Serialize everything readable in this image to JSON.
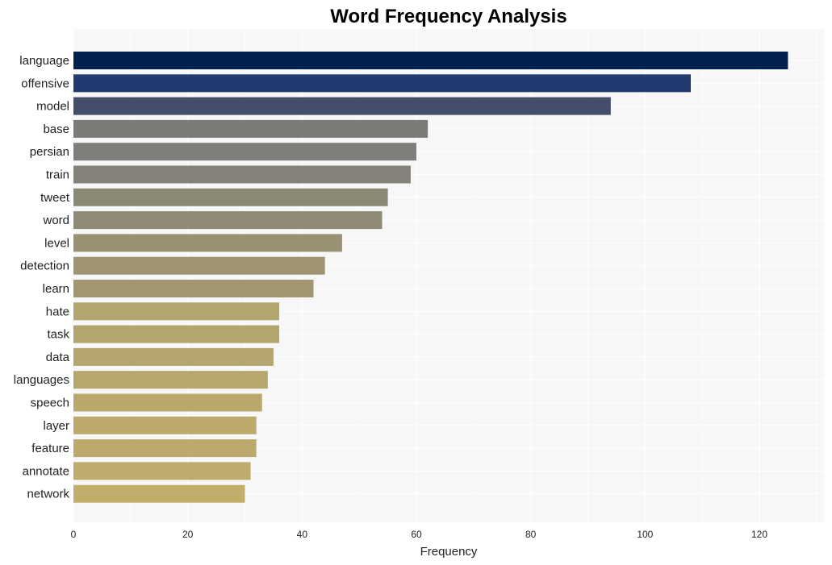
{
  "chart_data": {
    "type": "bar",
    "orientation": "horizontal",
    "title": "Word Frequency Analysis",
    "xlabel": "Frequency",
    "ylabel": "",
    "xlim": [
      0,
      131
    ],
    "xticks": [
      0,
      20,
      40,
      60,
      80,
      100,
      120
    ],
    "grid": true,
    "categories": [
      "language",
      "offensive",
      "model",
      "base",
      "persian",
      "train",
      "tweet",
      "word",
      "level",
      "detection",
      "learn",
      "hate",
      "task",
      "data",
      "languages",
      "speech",
      "layer",
      "feature",
      "annotate",
      "network"
    ],
    "values": [
      125,
      108,
      94,
      62,
      60,
      59,
      55,
      54,
      47,
      44,
      42,
      36,
      36,
      35,
      34,
      33,
      32,
      32,
      31,
      30
    ],
    "colors": [
      "#00204e",
      "#213a6f",
      "#434e6b",
      "#7d7b78",
      "#807e79",
      "#838178",
      "#8b8876",
      "#8e8a76",
      "#9a9172",
      "#9e9471",
      "#a29671",
      "#b3a56e",
      "#b3a56e",
      "#b4a56e",
      "#b6a76d",
      "#b8a86c",
      "#bbaa6c",
      "#bbaa6c",
      "#bdac6b",
      "#c1ae6a"
    ]
  }
}
